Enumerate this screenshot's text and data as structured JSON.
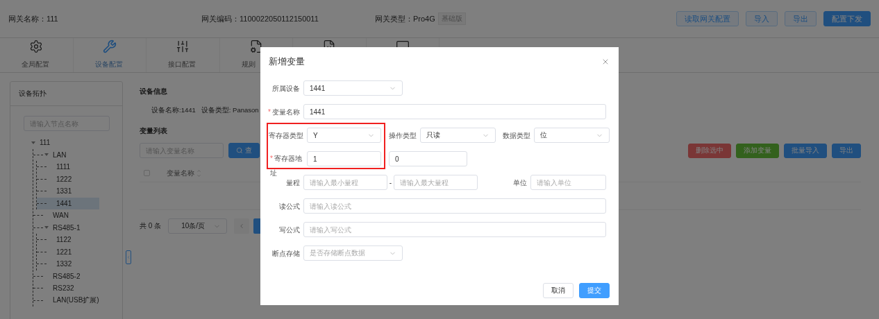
{
  "header": {
    "info": [
      "网关名称：111",
      "网关编码：1100022050112150011",
      "网关类型：Pro4G"
    ],
    "type_badge": "基础版",
    "buttons": [
      {
        "label": "读取网关配置",
        "kind": "plain"
      },
      {
        "label": "导入",
        "kind": "plain"
      },
      {
        "label": "导出",
        "kind": "plain"
      },
      {
        "label": "配置下发",
        "kind": "primary"
      }
    ]
  },
  "nav_tabs": [
    {
      "kind": "gear",
      "label": "全局配置",
      "selected": false
    },
    {
      "kind": "wrench",
      "label": "设备配置",
      "selected": true
    },
    {
      "kind": "sliders",
      "label": "接口配置",
      "selected": false
    },
    {
      "kind": "file-gear",
      "label": "规则",
      "selected": false
    },
    {
      "kind": "code",
      "selected": false
    },
    {
      "kind": "monitor",
      "selected": false
    }
  ],
  "topology": {
    "title": "设备拓扑",
    "search_placeholder": "请输入节点名称",
    "tree": [
      {
        "label": "111",
        "expanded": true,
        "selected": false,
        "children": [
          {
            "label": "LAN",
            "expanded": true,
            "selected": false,
            "children": [
              {
                "label": "1111",
                "selected": false
              },
              {
                "label": "1222",
                "selected": false
              },
              {
                "label": "1331",
                "selected": false
              },
              {
                "label": "1441",
                "selected": true
              }
            ]
          },
          {
            "label": "WAN",
            "selected": false
          },
          {
            "label": "RS485-1",
            "expanded": true,
            "selected": false,
            "children": [
              {
                "label": "1122",
                "selected": false
              },
              {
                "label": "1221",
                "selected": false
              },
              {
                "label": "1332",
                "selected": false
              }
            ]
          },
          {
            "label": "RS485-2",
            "selected": false
          },
          {
            "label": "RS232",
            "selected": false
          },
          {
            "label": "LAN(USB扩展)",
            "selected": false
          }
        ]
      }
    ]
  },
  "device_info": {
    "title": "设备信息",
    "fields": [
      "设备名称:1441",
      "设备类型: Panason"
    ]
  },
  "variables": {
    "title": "变量列表",
    "search_placeholder": "请输入变量名称",
    "query_button": "查",
    "actions": [
      {
        "label": "删除选中",
        "kind": "danger"
      },
      {
        "label": "添加变量",
        "kind": "success"
      },
      {
        "label": "批量导入",
        "kind": "primary"
      },
      {
        "label": "导出",
        "kind": "primary"
      }
    ],
    "table": {
      "select_all_checked": false,
      "columns": [
        {
          "label": "变量名称",
          "sortable": true
        }
      ]
    },
    "pagination": {
      "total": "共 0 条",
      "page_size": "10条/页"
    }
  },
  "dialog": {
    "title": "新增变量",
    "highlight_frame": true,
    "form": [
      {
        "kind": "select",
        "label": "所属设备",
        "value": "1441"
      },
      {
        "kind": "text",
        "label": "变量名称",
        "required_mark": "*",
        "value": "1441"
      },
      {
        "kind": "select-row",
        "items": [
          {
            "label": "寄存器类型",
            "value": "Y"
          },
          {
            "label": "操作类型",
            "value": "只读"
          },
          {
            "label": "数据类型",
            "value": "位"
          }
        ]
      },
      {
        "kind": "address",
        "label": "寄存器地址",
        "required_mark": "*",
        "values": [
          "1",
          "0"
        ]
      },
      {
        "kind": "range",
        "label": "量程",
        "min_placeholder": "请输入最小量程",
        "separator": "-",
        "max_placeholder": "请输入最大量程",
        "unit_label": "单位",
        "unit_placeholder": "请输入单位"
      },
      {
        "kind": "text",
        "label": "读公式",
        "placeholder": "请输入读公式"
      },
      {
        "kind": "text",
        "label": "写公式",
        "placeholder": "请输入写公式"
      },
      {
        "kind": "select",
        "label": "断点存储",
        "placeholder": "是否存储断点数据"
      }
    ],
    "buttons": [
      {
        "label": "取消",
        "kind": "plain"
      },
      {
        "label": "提交",
        "kind": "primary"
      }
    ]
  }
}
